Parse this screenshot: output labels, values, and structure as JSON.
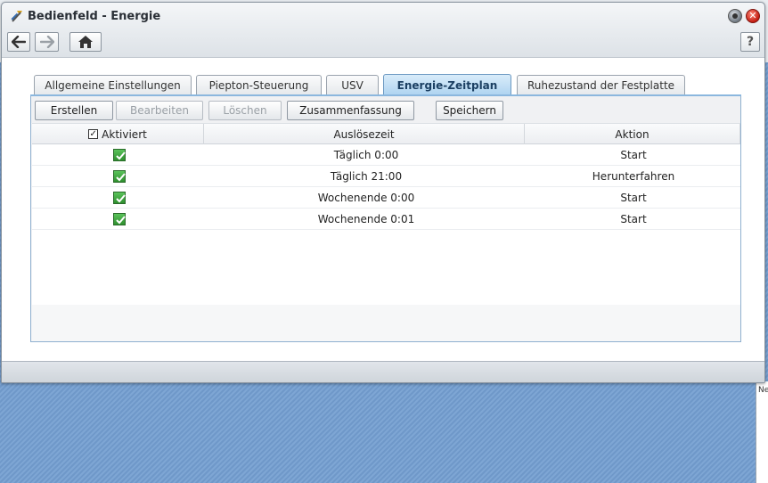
{
  "window": {
    "title": "Bedienfeld - Energie",
    "close_glyph": "✕",
    "help_label": "?"
  },
  "tabs": [
    {
      "label": "Allgemeine Einstellungen",
      "active": false
    },
    {
      "label": "Piepton-Steuerung",
      "active": false
    },
    {
      "label": "USV",
      "active": false
    },
    {
      "label": "Energie-Zeitplan",
      "active": true
    },
    {
      "label": "Ruhezustand der Festplatte",
      "active": false
    }
  ],
  "actions": {
    "create": "Erstellen",
    "edit": "Bearbeiten",
    "delete": "Löschen",
    "summary": "Zusammenfassung",
    "save": "Speichern"
  },
  "table": {
    "headers": {
      "enabled": "Aktiviert",
      "trigger_time": "Auslösezeit",
      "action": "Aktion"
    },
    "rows": [
      {
        "enabled": true,
        "trigger_time": "Täglich 0:00",
        "action": "Start"
      },
      {
        "enabled": true,
        "trigger_time": "Täglich 21:00",
        "action": "Herunterfahren"
      },
      {
        "enabled": true,
        "trigger_time": "Wochenende 0:00",
        "action": "Start"
      },
      {
        "enabled": true,
        "trigger_time": "Wochenende 0:01",
        "action": "Start"
      }
    ]
  },
  "side_panel_text": [
    "Ne"
  ],
  "colors": {
    "accent": "#aed3f0",
    "checkbox_green": "#2e8f2e",
    "close_red": "#c31d12"
  },
  "icons": [
    "app-icon",
    "back-arrow-icon",
    "forward-arrow-icon",
    "home-icon",
    "help-icon",
    "close-icon"
  ]
}
